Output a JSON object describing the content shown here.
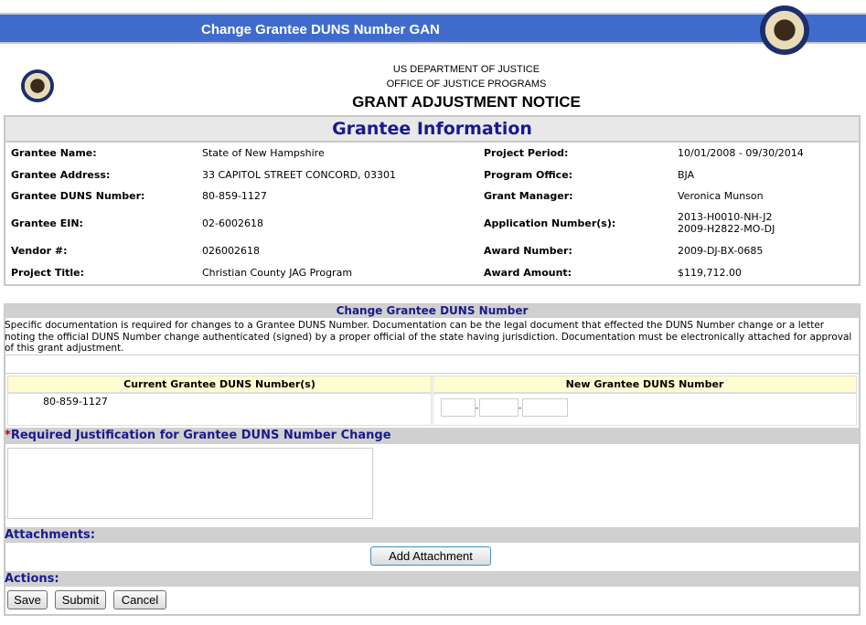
{
  "header": {
    "title": "Change Grantee DUNS Number GAN"
  },
  "agency": {
    "line1": "US DEPARTMENT OF JUSTICE",
    "line2": "OFFICE OF JUSTICE PROGRAMS",
    "title": "GRANT ADJUSTMENT NOTICE"
  },
  "grantee": {
    "heading": "Grantee Information",
    "left": [
      {
        "label": "Grantee Name:",
        "value": "State of New Hampshire"
      },
      {
        "label": "Grantee Address:",
        "value": "33 CAPITOL STREET CONCORD, 03301"
      },
      {
        "label": "Grantee DUNS Number:",
        "value": "80-859-1127"
      },
      {
        "label": "Grantee EIN:",
        "value": "02-6002618"
      },
      {
        "label": "Vendor #:",
        "value": "026002618"
      },
      {
        "label": "Project Title:",
        "value": "Christian County JAG Program"
      }
    ],
    "right": [
      {
        "label": "Project Period:",
        "value": "10/01/2008 - 09/30/2014"
      },
      {
        "label": "Program Office:",
        "value": "BJA"
      },
      {
        "label": "Grant Manager:",
        "value": "Veronica Munson"
      },
      {
        "label": "Application Number(s):",
        "value": "2013-H0010-NH-J2",
        "value2": "2009-H2822-MO-DJ"
      },
      {
        "label": "Award Number:",
        "value": "2009-DJ-BX-0685"
      },
      {
        "label": "Award Amount:",
        "value": "$119,712.00"
      }
    ]
  },
  "change": {
    "heading": "Change Grantee DUNS Number",
    "description": "Specific documentation is required for changes to a Grantee DUNS Number. Documentation can be the legal document that effected the DUNS Number change or a letter noting the official DUNS Number change authenticated (signed) by a proper official of the state having jurisdiction. Documentation must be electronically attached for approval of this grant adjustment.",
    "current_header": "Current Grantee DUNS Number(s)",
    "new_header": "New Grantee DUNS Number",
    "current_value": "80-859-1127",
    "dash": "-"
  },
  "justification": {
    "asterisk": "*",
    "label": "Required Justification for Grantee DUNS Number Change",
    "value": ""
  },
  "attachments": {
    "heading": "Attachments:",
    "add_label": "Add Attachment"
  },
  "actions": {
    "heading": "Actions:",
    "save": "Save",
    "submit": "Submit",
    "cancel": "Cancel"
  }
}
